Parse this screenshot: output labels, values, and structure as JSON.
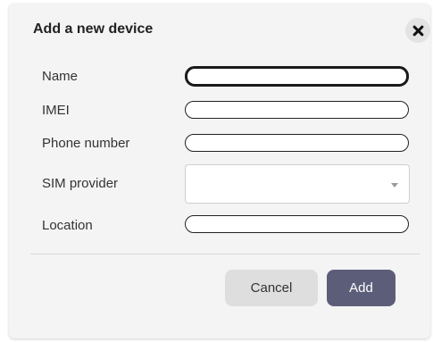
{
  "dialog": {
    "title": "Add a new device",
    "close_icon": "close-icon"
  },
  "form": {
    "name_label": "Name",
    "name_value": "",
    "imei_label": "IMEI",
    "imei_value": "",
    "phone_label": "Phone number",
    "phone_value": "",
    "sim_label": "SIM provider",
    "sim_value": "",
    "location_label": "Location",
    "location_value": ""
  },
  "buttons": {
    "cancel_label": "Cancel",
    "add_label": "Add"
  },
  "colors": {
    "dialog_background": "#f4f4f4",
    "add_button": "#5c5e79",
    "cancel_button": "#dedede"
  }
}
